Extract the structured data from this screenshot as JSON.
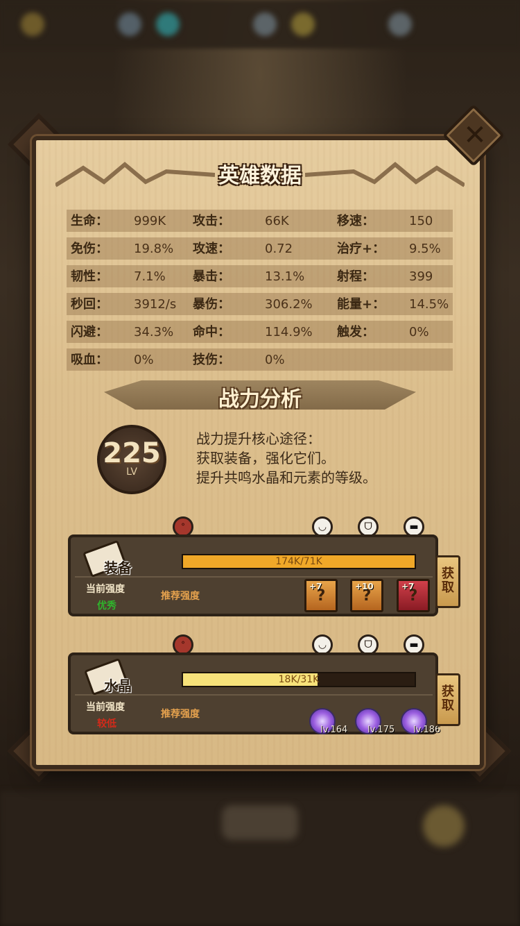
{
  "panel": {
    "title": "英雄数据",
    "analysis_title": "战力分析"
  },
  "stats": [
    [
      {
        "label": "生命：",
        "value": "999K"
      },
      {
        "label": "攻击：",
        "value": "66K"
      },
      {
        "label": "移速：",
        "value": "150"
      }
    ],
    [
      {
        "label": "免伤：",
        "value": "19.8%"
      },
      {
        "label": "攻速：",
        "value": "0.72"
      },
      {
        "label": "治疗+：",
        "value": "9.5%"
      }
    ],
    [
      {
        "label": "韧性：",
        "value": "7.1%"
      },
      {
        "label": "暴击：",
        "value": "13.1%"
      },
      {
        "label": "射程：",
        "value": "399"
      }
    ],
    [
      {
        "label": "秒回：",
        "value": "3912/s"
      },
      {
        "label": "暴伤：",
        "value": "306.2%"
      },
      {
        "label": "能量+：",
        "value": "14.5%"
      }
    ],
    [
      {
        "label": "闪避：",
        "value": "34.3%"
      },
      {
        "label": "命中：",
        "value": "114.9%"
      },
      {
        "label": "触发：",
        "value": "0%"
      }
    ],
    [
      {
        "label": "吸血：",
        "value": "0%"
      },
      {
        "label": "技伤：",
        "value": "0%"
      }
    ]
  ],
  "level": {
    "number": "225",
    "label": "LV"
  },
  "tips": [
    "战力提升核心途径：",
    "获取装备，强化它们。",
    "提升共鸣水晶和元素的等级。"
  ],
  "equipment": {
    "name": "装备",
    "progress_text": "174K/71K",
    "progress": 1.0,
    "current_label": "当前强度",
    "current_value": "优秀",
    "recommend_label": "推荐强度",
    "get_label": "获取",
    "items": [
      {
        "plus": "+7",
        "icon": "?"
      },
      {
        "plus": "+10",
        "icon": "?"
      },
      {
        "plus": "+7",
        "icon": "?"
      }
    ]
  },
  "crystal": {
    "name": "水晶",
    "progress_text": "18K/31K",
    "progress": 0.58,
    "current_label": "当前强度",
    "current_value": "较低",
    "recommend_label": "推荐强度",
    "get_label": "获取",
    "levels": [
      "lv.164",
      "lv.175",
      "lv.186"
    ]
  },
  "colors": {
    "excellent": "#2fb52c",
    "low": "#d42a1a",
    "bar_fill_equip": "#f0a828",
    "bar_fill_crystal": "#f7e27a"
  },
  "icons": {
    "close": "close-icon",
    "faces": [
      "angry-face-icon",
      "smile-face-icon",
      "grin-face-icon",
      "cool-face-icon"
    ]
  }
}
